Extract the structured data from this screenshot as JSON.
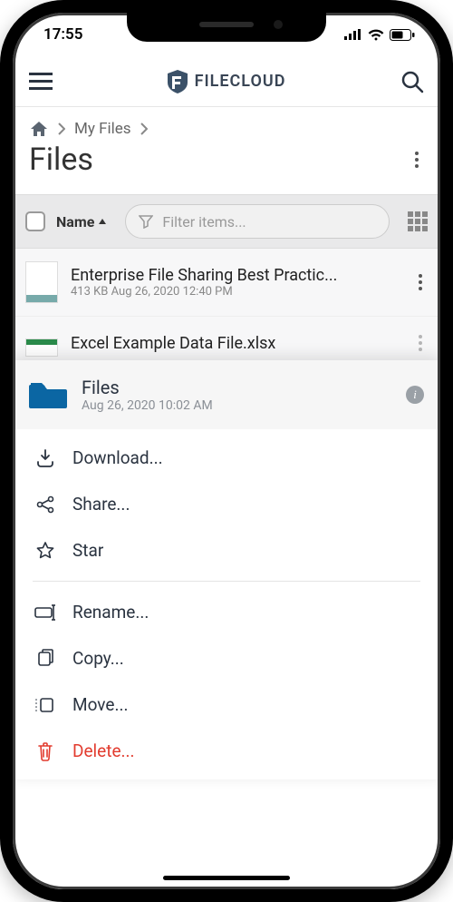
{
  "status": {
    "time": "17:55"
  },
  "brand": {
    "name": "FILECLOUD"
  },
  "breadcrumbs": {
    "root_icon": "home",
    "path1": "My Files"
  },
  "page": {
    "title": "Files"
  },
  "list_header": {
    "name_label": "Name",
    "filter_placeholder": "Filter items..."
  },
  "files": [
    {
      "name": "Enterprise File Sharing Best Practic...",
      "meta": "413 KB Aug 26, 2020 12:40 PM"
    },
    {
      "name": "Excel Example Data File.xlsx",
      "meta": ""
    }
  ],
  "sheet": {
    "title": "Files",
    "subtitle": "Aug 26, 2020 10:02 AM",
    "actions": {
      "download": "Download...",
      "share": "Share...",
      "star": "Star",
      "rename": "Rename...",
      "copy": "Copy...",
      "move": "Move...",
      "delete": "Delete..."
    }
  }
}
